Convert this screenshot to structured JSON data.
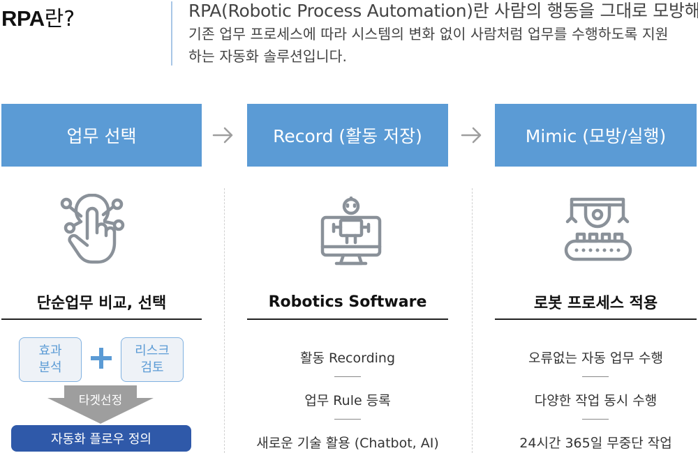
{
  "header": {
    "title_bold": "RPA",
    "title_suffix": "란?",
    "intro_lines": [
      "RPA(Robotic Process Automation)란 사람의 행동을 그대로 모방해",
      "기존 업무 프로세스에 따라 시스템의 변화 없이 사람처럼 업무를 수행하도록 지원",
      "하는 자동화 솔루션입니다."
    ]
  },
  "steps": [
    {
      "label": "업무 선택"
    },
    {
      "label": "Record (활동 저장)"
    },
    {
      "label": "Mimic (모방/실행)"
    }
  ],
  "columns": [
    {
      "icon": "touch-hand-icon",
      "title": "단순업무 비교, 선택",
      "left_box": "효과\n분석",
      "right_box": "리스크\n검토",
      "arrow_label": "타겟선정",
      "result": "자동화 플로우 정의"
    },
    {
      "icon": "robot-monitor-icon",
      "title": "Robotics Software",
      "features": [
        "활동 Recording",
        "업무 Rule 등록",
        "새로운 기술 활용 (Chatbot, AI)"
      ]
    },
    {
      "icon": "robot-arm-conveyor-icon",
      "title": "로봇 프로세스 적용",
      "features": [
        "오류없는 자동 업무 수행",
        "다양한 작업 동시 수행",
        "24시간 365일 무중단 작업"
      ]
    }
  ],
  "colors": {
    "step_blue": "#5b9bd5",
    "icon_gray": "#8a9199",
    "result_blue": "#2f59a9",
    "box_border": "#7fb0e0",
    "box_bg": "#eef2f7",
    "arrow_gray": "#9e9e9e"
  }
}
